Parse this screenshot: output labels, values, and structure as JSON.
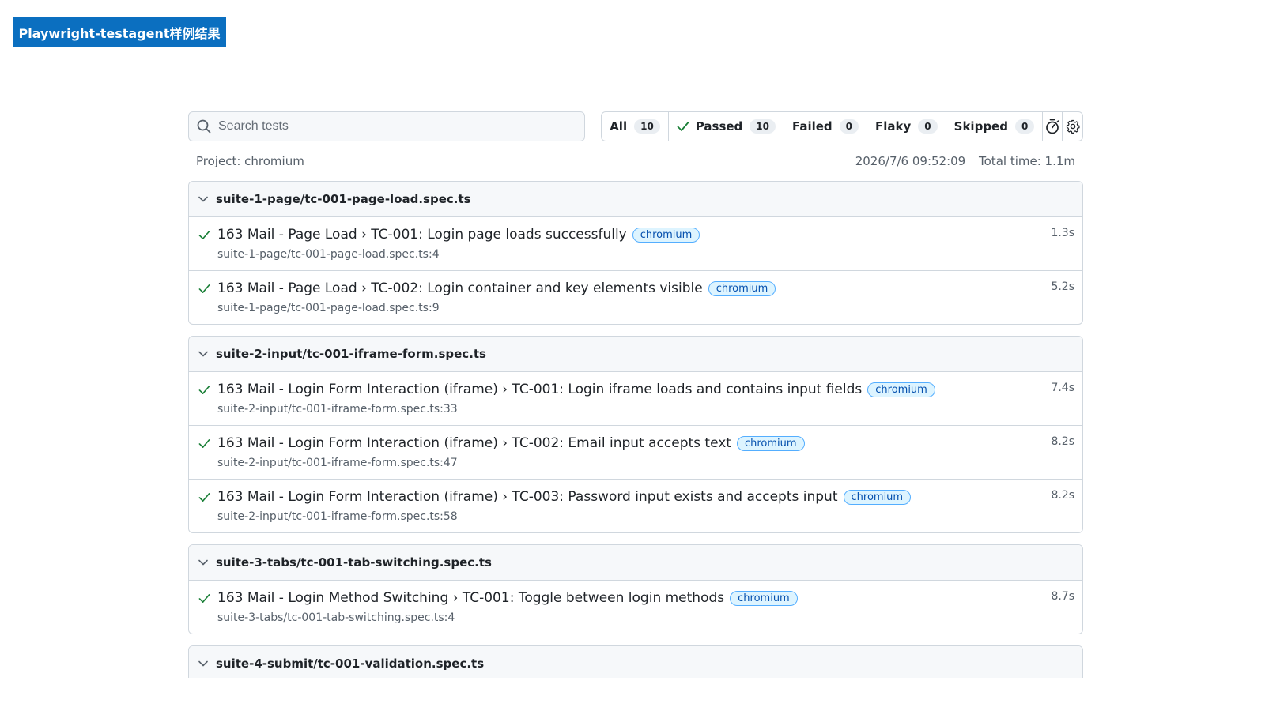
{
  "banner": {
    "title": "Playwright-testagent样例结果"
  },
  "search": {
    "placeholder": "Search tests"
  },
  "filters": [
    {
      "label": "All",
      "count": "10"
    },
    {
      "label": "Passed",
      "count": "10"
    },
    {
      "label": "Failed",
      "count": "0"
    },
    {
      "label": "Flaky",
      "count": "0"
    },
    {
      "label": "Skipped",
      "count": "0"
    }
  ],
  "meta": {
    "project": "Project: chromium",
    "timestamp": "2026/7/6 09:52:09",
    "total_time": "Total time: 1.1m"
  },
  "suites": [
    {
      "name": "suite-1-page/tc-001-page-load.spec.ts",
      "tests": [
        {
          "title": "163 Mail - Page Load › TC-001: Login page loads successfully",
          "tag": "chromium",
          "location": "suite-1-page/tc-001-page-load.spec.ts:4",
          "duration": "1.3s"
        },
        {
          "title": "163 Mail - Page Load › TC-002: Login container and key elements visible",
          "tag": "chromium",
          "location": "suite-1-page/tc-001-page-load.spec.ts:9",
          "duration": "5.2s"
        }
      ]
    },
    {
      "name": "suite-2-input/tc-001-iframe-form.spec.ts",
      "tests": [
        {
          "title": "163 Mail - Login Form Interaction (iframe) › TC-001: Login iframe loads and contains input fields",
          "tag": "chromium",
          "location": "suite-2-input/tc-001-iframe-form.spec.ts:33",
          "duration": "7.4s"
        },
        {
          "title": "163 Mail - Login Form Interaction (iframe) › TC-002: Email input accepts text",
          "tag": "chromium",
          "location": "suite-2-input/tc-001-iframe-form.spec.ts:47",
          "duration": "8.2s"
        },
        {
          "title": "163 Mail - Login Form Interaction (iframe) › TC-003: Password input exists and accepts input",
          "tag": "chromium",
          "location": "suite-2-input/tc-001-iframe-form.spec.ts:58",
          "duration": "8.2s"
        }
      ]
    },
    {
      "name": "suite-3-tabs/tc-001-tab-switching.spec.ts",
      "tests": [
        {
          "title": "163 Mail - Login Method Switching › TC-001: Toggle between login methods",
          "tag": "chromium",
          "location": "suite-3-tabs/tc-001-tab-switching.spec.ts:4",
          "duration": "8.7s"
        }
      ]
    },
    {
      "name": "suite-4-submit/tc-001-validation.spec.ts",
      "tests": []
    }
  ],
  "colors": {
    "pass": "#1a7f37",
    "banner": "#0b6fc0",
    "tag_text": "#0550ae"
  },
  "icons": {
    "search": "search-icon",
    "check": "check-icon",
    "chevron": "chevron-down-icon",
    "stopwatch": "stopwatch-icon",
    "settings": "gear-icon"
  }
}
